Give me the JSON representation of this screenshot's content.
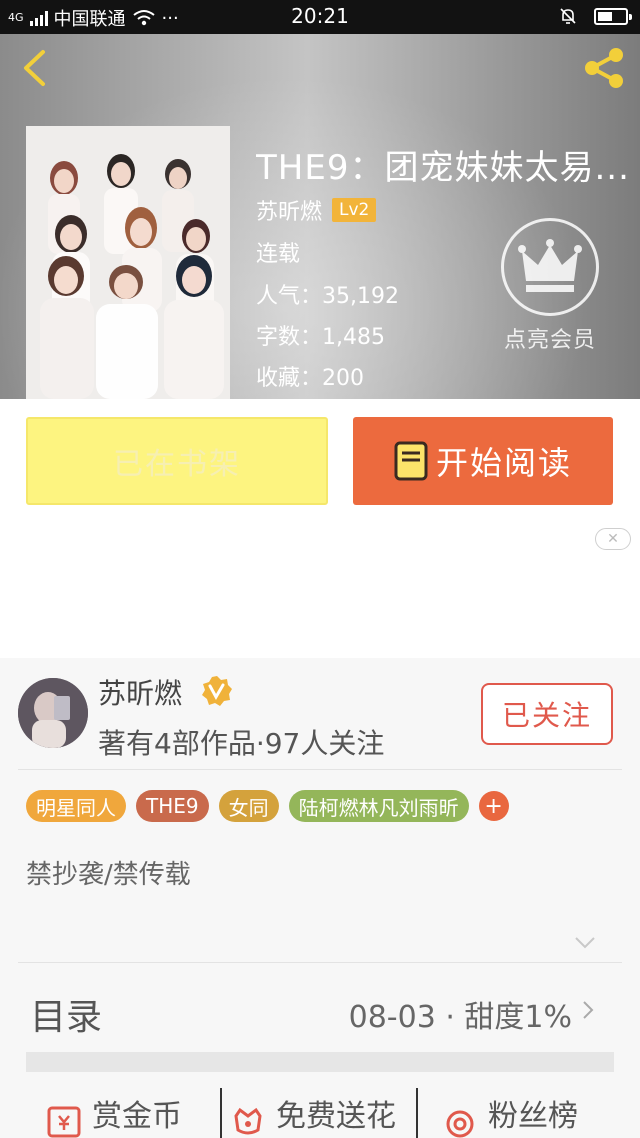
{
  "status_bar": {
    "carrier": "中国联通",
    "signal_label": "4G",
    "more": "···",
    "time": "20:21",
    "battery_level": 0.55
  },
  "header": {
    "book_title": "THE9：团宠妹妹太易...",
    "author": "苏昕燃",
    "author_level": "Lv2",
    "status": "连载",
    "popularity": "人气：35,192",
    "word_count": "字数：1,485",
    "favorites": "收藏：200",
    "vip_label": "点亮会员",
    "icons": {
      "back": "chevron-left-icon",
      "share": "share-icon",
      "vip": "crown-icon"
    },
    "accent_color": "#f2cf3a"
  },
  "actions": {
    "shelf_label": "已在书架",
    "read_label": "开始阅读",
    "read_color": "#ec6a3e",
    "shelf_color": "#fdf480"
  },
  "author_card": {
    "name": "苏昕燃",
    "stats": "著有4部作品·97人关注",
    "follow_label": "已关注"
  },
  "tags": [
    {
      "label": "明星同人",
      "color": "#f0a73c"
    },
    {
      "label": "THE9",
      "color": "#c96a4c"
    },
    {
      "label": "女同",
      "color": "#d4a23c"
    },
    {
      "label": "陆柯燃林凡刘雨昕",
      "color": "#94b65a"
    }
  ],
  "tag_add": "+",
  "notice": "禁抄袭/禁传载",
  "catalog": {
    "title": "目录",
    "info": "08-03 · 甜度1%"
  },
  "bottom_actions": [
    {
      "label": "赏金币",
      "icon": "coin-envelope-icon"
    },
    {
      "label": "免费送花",
      "icon": "flower-icon"
    },
    {
      "label": "粉丝榜",
      "icon": "rank-medal-icon"
    }
  ],
  "ad_close": "✕"
}
